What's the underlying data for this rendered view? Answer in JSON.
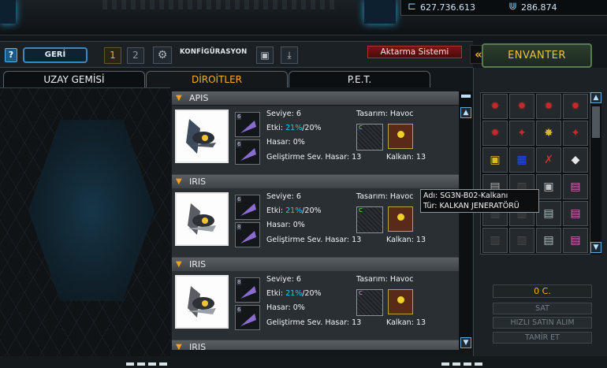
{
  "header": {
    "currency": [
      {
        "icon": "credit-icon",
        "value": "627.736.613"
      },
      {
        "icon": "uridium-icon",
        "value": "286.874"
      }
    ]
  },
  "toolbar": {
    "help_label": "?",
    "back_label": "GERİ",
    "config_numbers": [
      "1",
      "2"
    ],
    "config_label": "KONFİGÜRASYON",
    "transfer_label": "Aktarma Sistemi"
  },
  "tabs": [
    "UZAY GEMİSİ",
    "DİROİTLER",
    "P.E.T."
  ],
  "drones": [
    {
      "name": "APIS",
      "level_label": "Seviye: 6",
      "effect_label": "Etki:",
      "effect_value": "21%",
      "effect_max": "/20%",
      "damage_label": "Hasar: 0%",
      "upgrade_label": "Geliştirme Sev. Hasar: 13",
      "design_label": "Tasarım: Havoc",
      "shield_label": "Kalkan: 13",
      "slots": [
        "6",
        "6"
      ]
    },
    {
      "name": "IRIS",
      "level_label": "Seviye: 6",
      "effect_label": "Etki:",
      "effect_value": "21%",
      "effect_max": "/20%",
      "damage_label": "Hasar: 0%",
      "upgrade_label": "Geliştirme Sev. Hasar: 13",
      "design_label": "Tasarım: Havoc",
      "shield_label": "Kalkan: 13",
      "slots": [
        "6",
        "8"
      ]
    },
    {
      "name": "IRIS",
      "level_label": "Seviye: 6",
      "effect_label": "Etki:",
      "effect_value": "21%",
      "effect_max": "/20%",
      "damage_label": "Hasar: 0%",
      "upgrade_label": "Geliştirme Sev. Hasar: 13",
      "design_label": "Tasarım: Havoc",
      "shield_label": "Kalkan: 13",
      "slots": [
        "8",
        "6"
      ]
    },
    {
      "name": "IRIS"
    }
  ],
  "slot_mark": "C",
  "inventory": {
    "title": "ENVANTER",
    "price": "0 C.",
    "sell_label": "SAT",
    "quick_buy_label": "HIZLI SATIN ALIM",
    "repair_label": "TAMİR ET"
  },
  "tooltip": {
    "name": "Adı: SG3N-B02-Kalkanı",
    "type": "Tür: KALKAN JENERATÖRÜ"
  },
  "colors": {
    "accent": "#f0b030",
    "highlight": "#22c7e8",
    "danger": "#7a1414"
  }
}
